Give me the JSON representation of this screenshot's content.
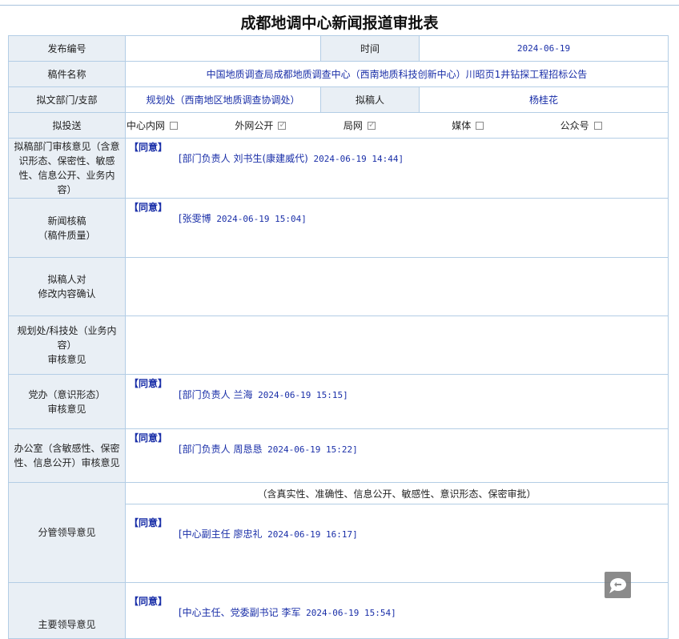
{
  "page": {
    "title": "成都地调中心新闻报道审批表"
  },
  "form": {
    "publish_no_label": "发布编号",
    "publish_no_value": "",
    "time_label": "时间",
    "time_value": "2024-06-19",
    "manuscript_label": "稿件名称",
    "manuscript_value": "中国地质调查局成都地质调查中心（西南地质科技创新中心）川昭页1井钻探工程招标公告",
    "dept_label": "拟文部门/支部",
    "dept_value": "规划处（西南地区地质调查协调处）",
    "drafter_label": "拟稿人",
    "drafter_value": "杨桂花",
    "send_label": "拟投送",
    "send_options": [
      {
        "label": "中心内网",
        "checked": false
      },
      {
        "label": "外网公开",
        "checked": true
      },
      {
        "label": "局网",
        "checked": true
      },
      {
        "label": "媒体",
        "checked": false
      },
      {
        "label": "公众号",
        "checked": false
      }
    ]
  },
  "opinions": {
    "dept_review": {
      "label": "拟稿部门审核意见（含意识形态、保密性、敏感性、信息公开、业务内容）",
      "agree": "【同意】",
      "signer": "[部门负责人 刘书生(康建威代)",
      "time": "2024-06-19 14:44]"
    },
    "news_review": {
      "label_line1": "新闻核稿",
      "label_line2": "（稿件质量）",
      "agree": "【同意】",
      "signer": "[张雯博",
      "time": "2024-06-19 15:04]"
    },
    "drafter_confirm": {
      "label_line1": "拟稿人对",
      "label_line2": "修改内容确认"
    },
    "planning_review": {
      "label_line1": "规划处/科技处（业务内容）",
      "label_line2": "审核意见"
    },
    "party_office": {
      "label_line1": "党办（意识形态）",
      "label_line2": "审核意见",
      "agree": "【同意】",
      "signer": "[部门负责人 兰海",
      "time": "2024-06-19 15:15]"
    },
    "office": {
      "label": "办公室（含敏感性、保密性、信息公开）审核意见",
      "agree": "【同意】",
      "signer": "[部门负责人 周恳恳",
      "time": "2024-06-19 15:22]"
    },
    "leader_in_charge": {
      "label": "分管领导意见",
      "note": "（含真实性、准确性、信息公开、敏感性、意识形态、保密审批）",
      "agree": "【同意】",
      "signer": "[中心副主任 廖忠礼",
      "time": "2024-06-19 16:17]"
    },
    "main_leader": {
      "label": "主要领导意见",
      "agree": "【同意】",
      "signer": "[中心主任、党委副书记 李军",
      "time": "2024-06-19 15:54]"
    }
  },
  "widgets": {
    "chat_icon": "speech-bubble-icon",
    "border_color": "#b3cde5",
    "label_bg": "#e9eff5",
    "accent_blue": "#1a2fa8"
  }
}
